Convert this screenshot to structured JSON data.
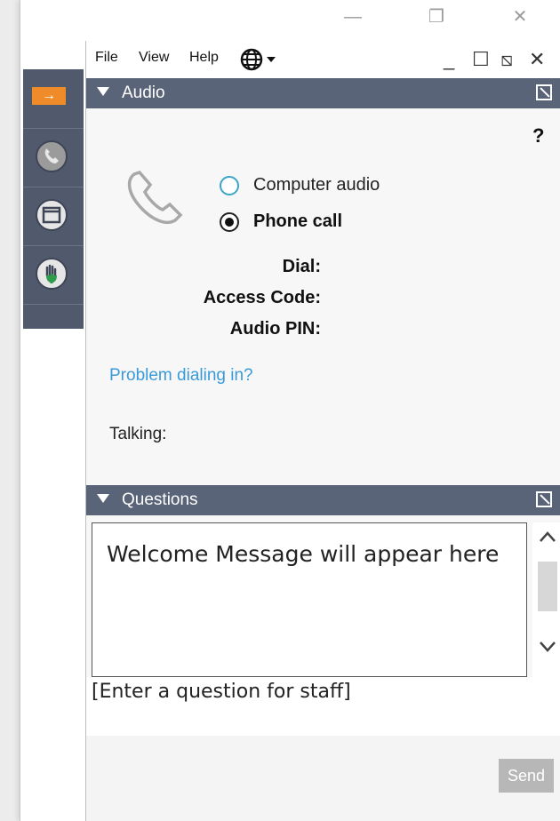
{
  "window_controls": {
    "minimize": "—",
    "maximize": "❐",
    "close": "✕"
  },
  "menu": {
    "file": "File",
    "view": "View",
    "help": "Help"
  },
  "panel_controls": {
    "minimize": "_",
    "maximize": "☐",
    "popout": "⧅",
    "close": "✕"
  },
  "sidebar": {
    "arrow": "→"
  },
  "audio": {
    "section_title": "Audio",
    "help": "?",
    "options": {
      "computer_audio": "Computer audio",
      "phone_call": "Phone call"
    },
    "fields": {
      "dial": "Dial:",
      "access_code": "Access Code:",
      "audio_pin": "Audio PIN:"
    },
    "problem_link": "Problem dialing in?",
    "talking_label": "Talking:"
  },
  "questions": {
    "section_title": "Questions",
    "welcome_message": "Welcome Message will appear here",
    "input_placeholder": "[Enter a question for staff]",
    "send_label": "Send"
  },
  "colors": {
    "section_bar": "#5a6478",
    "sidebar": "#515a6d",
    "accent_orange": "#f08b2a",
    "link": "#3a9ad9",
    "radio_outline": "#3aa5c9"
  }
}
